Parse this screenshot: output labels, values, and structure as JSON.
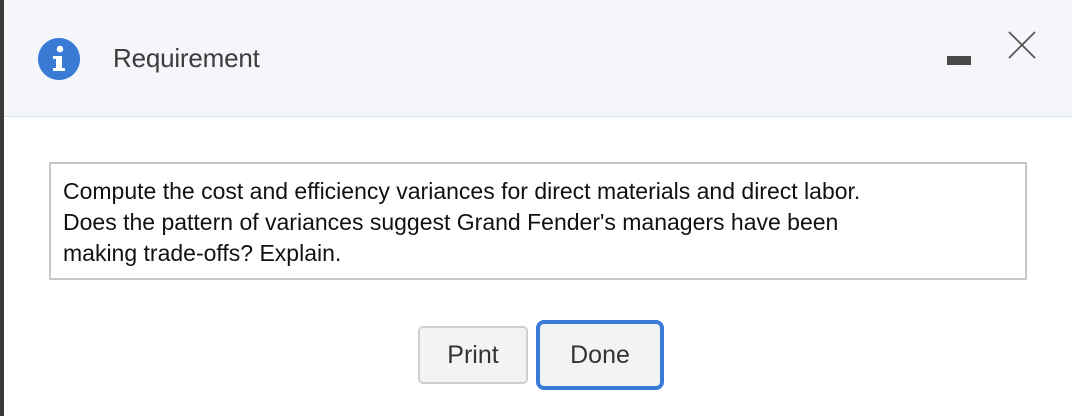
{
  "dialog": {
    "title": "Requirement",
    "icons": {
      "info": "info-icon",
      "minimize": "minimize-icon",
      "close": "close-icon"
    },
    "colors": {
      "accent": "#3a7bd5",
      "titlebar_bg": "#f4f6fa"
    }
  },
  "content": {
    "lines": [
      "Compute the cost and efficiency variances for direct materials and direct labor.",
      "Does the pattern of variances suggest Grand Fender's managers have been",
      "making trade-offs? Explain."
    ]
  },
  "buttons": {
    "print_label": "Print",
    "done_label": "Done"
  }
}
